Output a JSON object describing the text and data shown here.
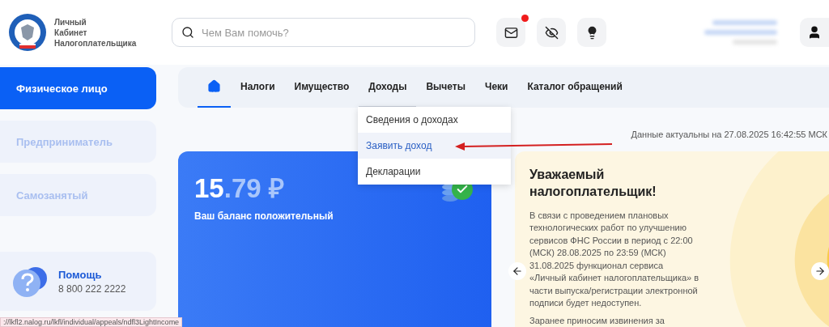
{
  "logo_text": [
    "Личный",
    "Кабинет",
    "Налогоплательщика"
  ],
  "search": {
    "placeholder": "Чем Вам помочь?"
  },
  "header_icons": [
    {
      "kind": "mail",
      "badge": true
    },
    {
      "kind": "eye",
      "badge": false
    },
    {
      "kind": "bulb",
      "badge": false
    }
  ],
  "sidebar": {
    "items": [
      {
        "label": "Физическое лицо",
        "selected": true
      },
      {
        "label": "Предприниматель",
        "selected": false
      },
      {
        "label": "Самозанятый",
        "selected": false
      }
    ],
    "help": {
      "title": "Помощь",
      "phone": "8 800 222 2222"
    }
  },
  "nav": {
    "tabs": [
      {
        "kind": "home",
        "selected": true
      },
      {
        "label": "Налоги",
        "selected": false
      },
      {
        "label": "Имущество",
        "selected": false
      },
      {
        "label": "Доходы",
        "selected": false,
        "open": true
      },
      {
        "label": "Вычеты",
        "selected": false
      },
      {
        "label": "Чеки",
        "selected": false
      },
      {
        "label": "Каталог обращений",
        "selected": false
      }
    ],
    "dropdown": [
      {
        "label": "Сведения о доходах",
        "selected": false
      },
      {
        "label": "Заявить доход",
        "selected": true
      },
      {
        "label": "Декларации",
        "selected": false
      }
    ]
  },
  "updated": "Данные актуальны на 27.08.2025 16:42:55 МСК",
  "balance": {
    "whole": "15",
    "fraction": ".79 ₽",
    "caption": "Ваш баланс положительный"
  },
  "notice": {
    "title": "Уважаемый налогоплательщик!",
    "paragraphs": [
      "В связи с проведением плановых технологических работ по улучшению сервисов ФНС России в период с 22:00 (МСК) 28.08.2025 по 23:59 (МСК) 31.08.2025 функционал сервиса «Личный кабинет налогоплательщика» в части выпуска/регистрации электронной подписи будет недоступен.",
      "Заранее приносим извинения за"
    ]
  },
  "status_url": "://lkfl2.nalog.ru/lkfl/individual/appeals/ndfl3LightIncome"
}
